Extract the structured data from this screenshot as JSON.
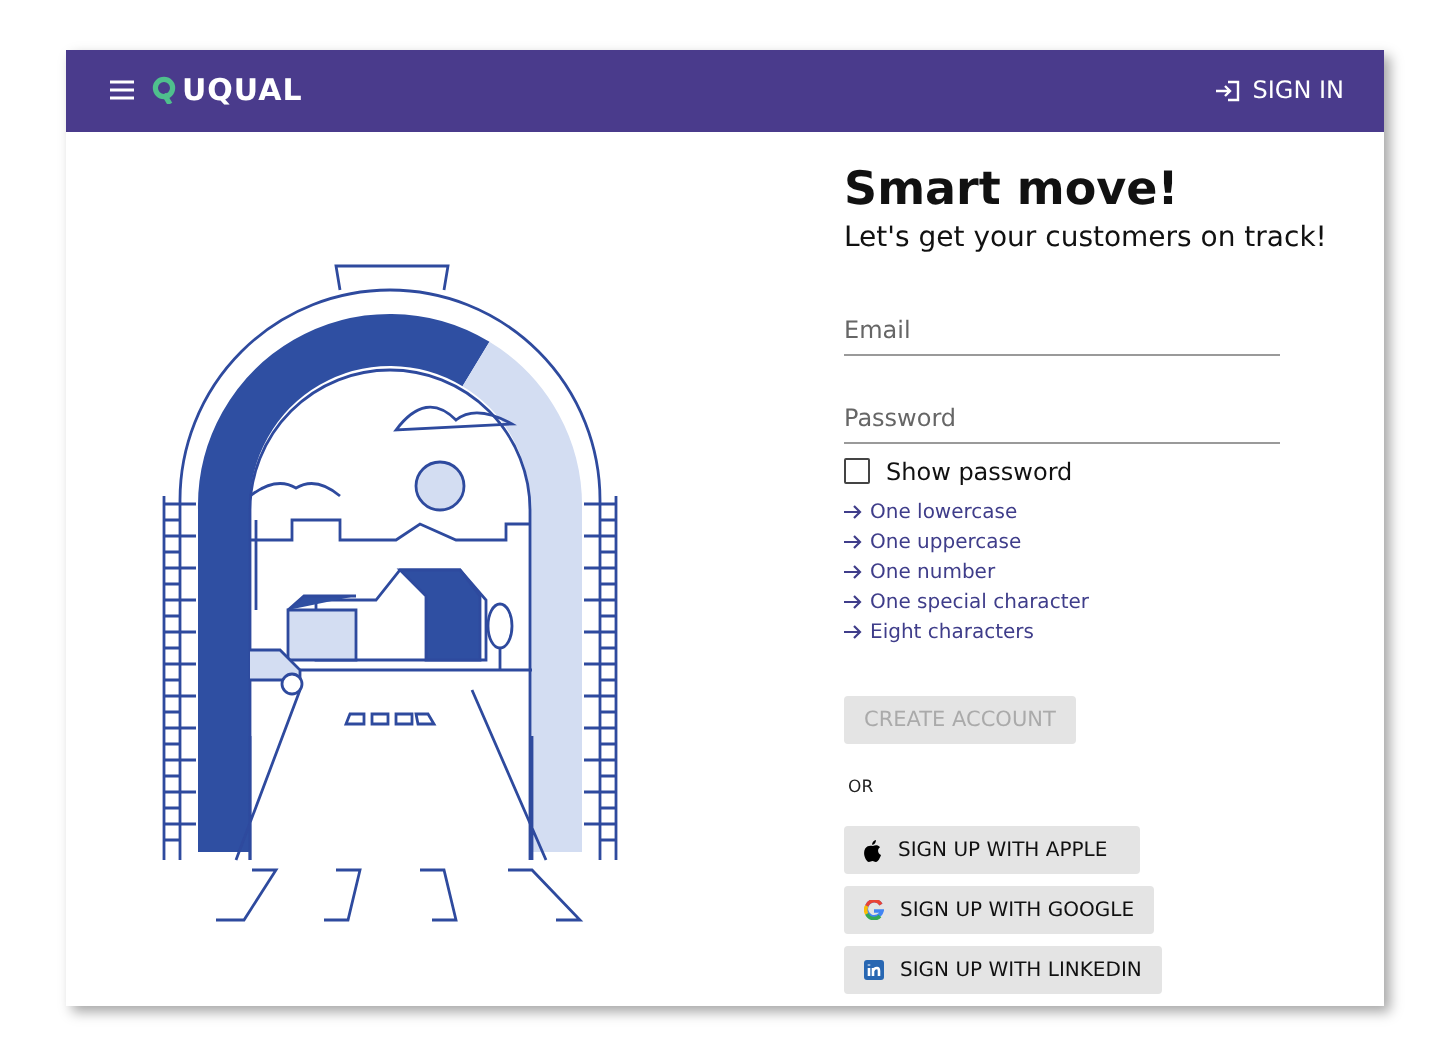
{
  "header": {
    "logo": "UQUAL",
    "sign_in": "SIGN IN"
  },
  "title": "Smart move!",
  "subtitle": "Let's get your customers on track!",
  "fields": [
    {
      "placeholder": "Email"
    },
    {
      "placeholder": "Password"
    }
  ],
  "show_password": {
    "label": "Show password",
    "checked": false
  },
  "requirements": [
    "One lowercase",
    "One uppercase",
    "One number",
    "One special character",
    "Eight characters"
  ],
  "create_button": {
    "label": "CREATE ACCOUNT",
    "disabled": true
  },
  "separator": "OR",
  "social_buttons": [
    {
      "kind": "apple",
      "label": "SIGN UP WITH APPLE"
    },
    {
      "kind": "google",
      "label": "SIGN UP WITH GOOGLE"
    },
    {
      "kind": "linkedin",
      "label": "SIGN UP WITH LINKEDIN"
    }
  ]
}
